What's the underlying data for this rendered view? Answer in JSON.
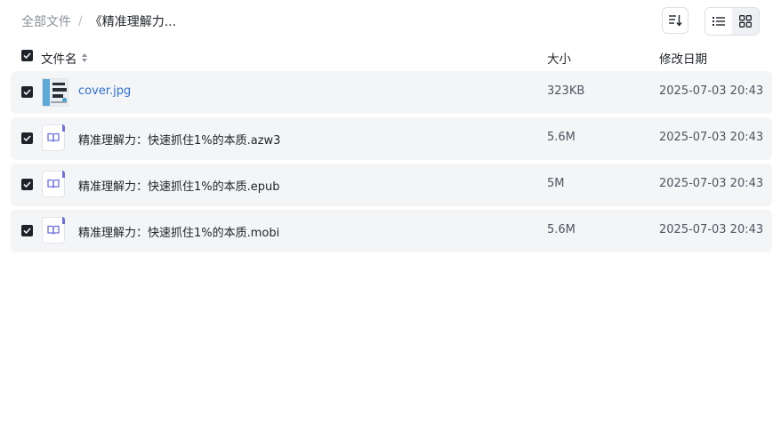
{
  "breadcrumb": {
    "root": "全部文件",
    "separator": "/",
    "current": "《精准理解力..."
  },
  "toolbar": {
    "sort_icon": "sort-lines-icon",
    "list_view_icon": "list-view-icon",
    "grid_view_icon": "grid-view-icon",
    "active_view": "list"
  },
  "table": {
    "columns": {
      "name": "文件名",
      "size": "大小",
      "modified": "修改日期"
    },
    "rows": [
      {
        "name": "cover.jpg",
        "size": "323KB",
        "modified": "2025-07-03 20:43",
        "type": "image",
        "selected": true
      },
      {
        "name": "精准理解力：快速抓住1%的本质.azw3",
        "size": "5.6M",
        "modified": "2025-07-03 20:43",
        "type": "ebook",
        "selected": true
      },
      {
        "name": "精准理解力：快速抓住1%的本质.epub",
        "size": "5M",
        "modified": "2025-07-03 20:43",
        "type": "ebook",
        "selected": true
      },
      {
        "name": "精准理解力：快速抓住1%的本质.mobi",
        "size": "5.6M",
        "modified": "2025-07-03 20:43",
        "type": "ebook",
        "selected": true
      }
    ]
  },
  "colors": {
    "accent": "#6c6fe0",
    "link": "#2f6fd8",
    "row_bg": "#f4f5f6"
  }
}
